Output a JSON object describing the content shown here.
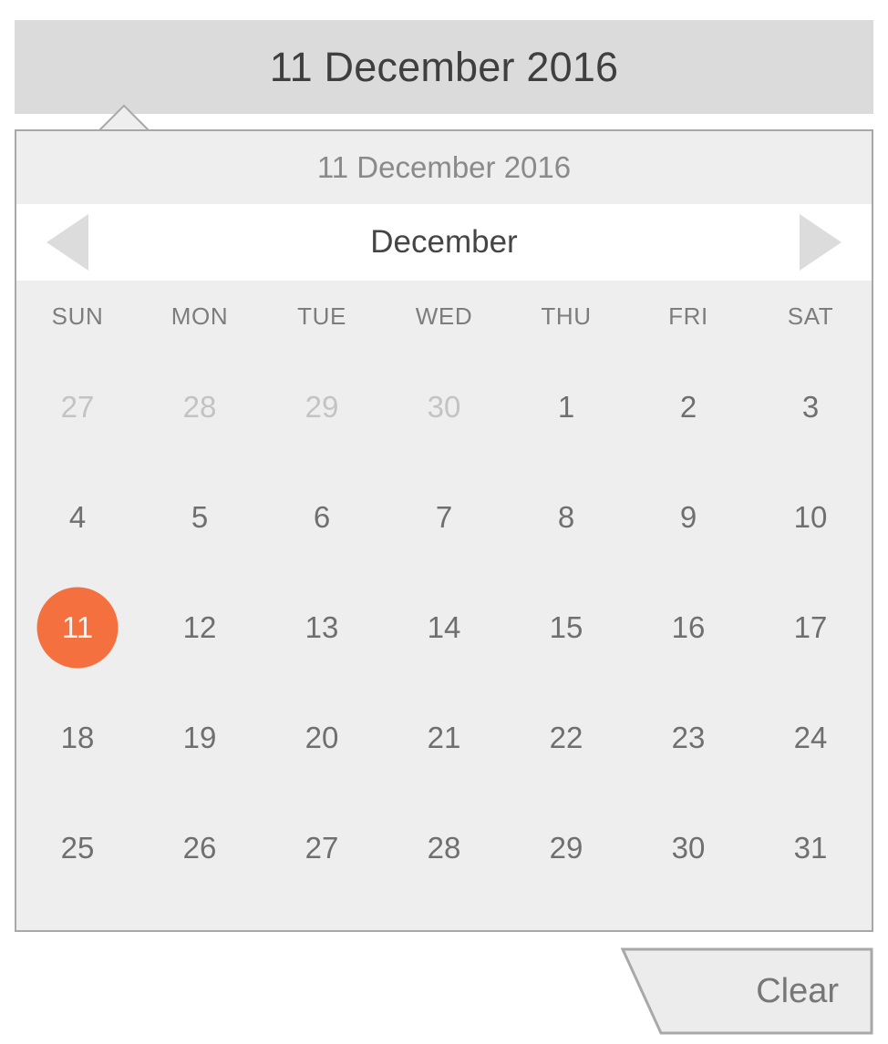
{
  "field": {
    "value": "11 December 2016",
    "name": "date-input-display"
  },
  "calendar": {
    "header_title": "11 December 2016",
    "month_label": "December",
    "prev_icon": "chevron-left-icon",
    "next_icon": "chevron-right-icon",
    "weekdays": [
      "SUN",
      "MON",
      "TUE",
      "WED",
      "THU",
      "FRI",
      "SAT"
    ],
    "weeks": [
      [
        {
          "label": "27",
          "state": "muted"
        },
        {
          "label": "28",
          "state": "muted"
        },
        {
          "label": "29",
          "state": "muted"
        },
        {
          "label": "30",
          "state": "muted"
        },
        {
          "label": "1",
          "state": "normal"
        },
        {
          "label": "2",
          "state": "normal"
        },
        {
          "label": "3",
          "state": "normal"
        }
      ],
      [
        {
          "label": "4",
          "state": "normal"
        },
        {
          "label": "5",
          "state": "normal"
        },
        {
          "label": "6",
          "state": "normal"
        },
        {
          "label": "7",
          "state": "normal"
        },
        {
          "label": "8",
          "state": "normal"
        },
        {
          "label": "9",
          "state": "normal"
        },
        {
          "label": "10",
          "state": "normal"
        }
      ],
      [
        {
          "label": "11",
          "state": "selected"
        },
        {
          "label": "12",
          "state": "normal"
        },
        {
          "label": "13",
          "state": "normal"
        },
        {
          "label": "14",
          "state": "normal"
        },
        {
          "label": "15",
          "state": "normal"
        },
        {
          "label": "16",
          "state": "normal"
        },
        {
          "label": "17",
          "state": "normal"
        }
      ],
      [
        {
          "label": "18",
          "state": "normal"
        },
        {
          "label": "19",
          "state": "normal"
        },
        {
          "label": "20",
          "state": "normal"
        },
        {
          "label": "21",
          "state": "normal"
        },
        {
          "label": "22",
          "state": "normal"
        },
        {
          "label": "23",
          "state": "normal"
        },
        {
          "label": "24",
          "state": "normal"
        }
      ],
      [
        {
          "label": "25",
          "state": "normal"
        },
        {
          "label": "26",
          "state": "normal"
        },
        {
          "label": "27",
          "state": "normal"
        },
        {
          "label": "28",
          "state": "normal"
        },
        {
          "label": "29",
          "state": "normal"
        },
        {
          "label": "30",
          "state": "normal"
        },
        {
          "label": "31",
          "state": "normal"
        }
      ]
    ],
    "selected_day": "11"
  },
  "actions": {
    "clear_label": "Clear"
  },
  "colors": {
    "field_background": "#dbdbdb",
    "panel_background": "#eeeeee",
    "panel_border": "#a8a8a8",
    "nav_background": "#ffffff",
    "accent_selected": "#f4713f",
    "selected_text": "#fdf0ea",
    "day_text": "#6f6f6f",
    "day_muted_text": "#c3c3c3",
    "weekday_text": "#7d7d7d",
    "arrow_fill": "#dcdcdc",
    "field_text": "#3f3f3f",
    "panel_title_text": "#8a8a8a",
    "month_label_text": "#454545",
    "clear_text": "#777777",
    "clear_background": "#ececec"
  }
}
